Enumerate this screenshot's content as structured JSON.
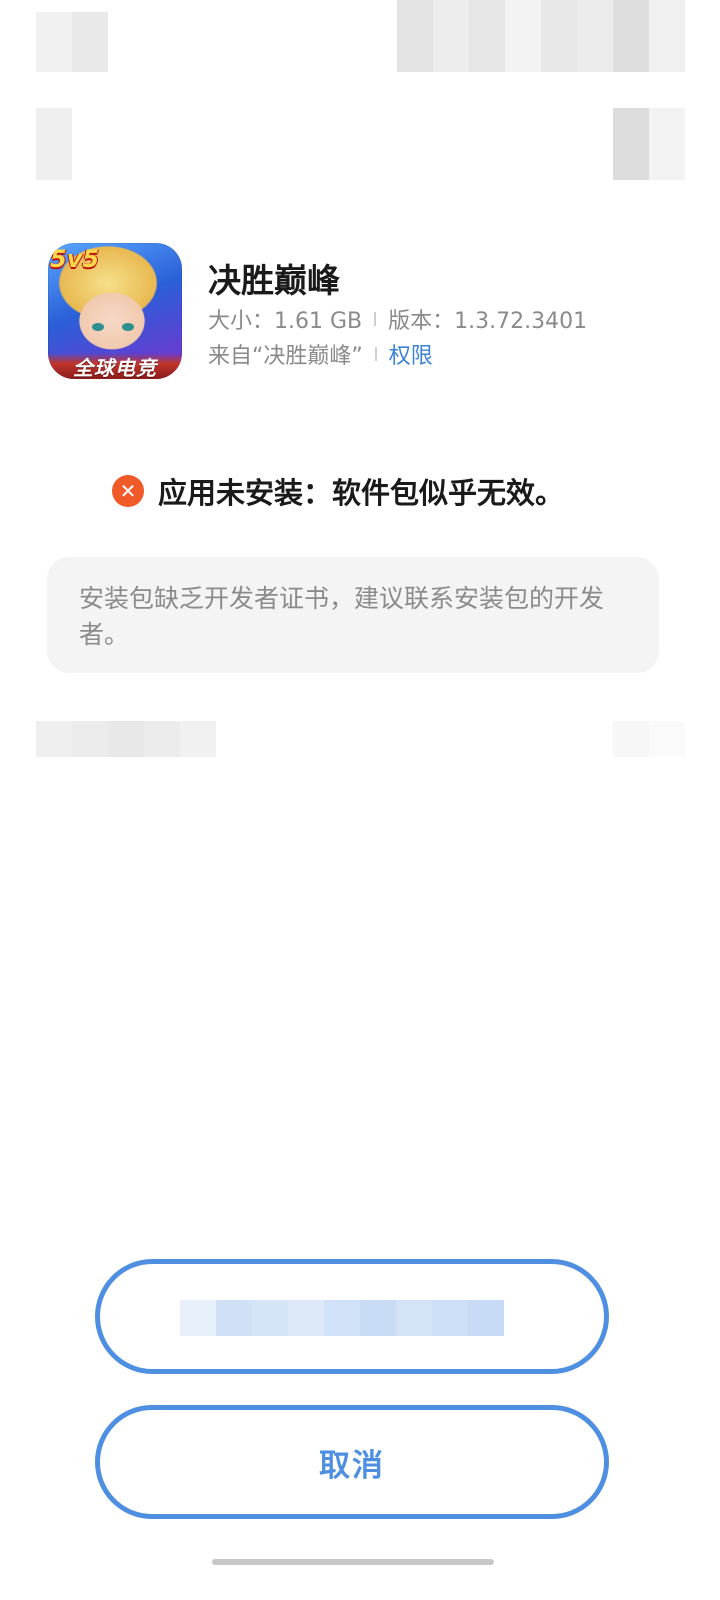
{
  "app": {
    "name": "决胜巅峰",
    "size_label": "大小：1.61 GB",
    "version_label": "版本：1.3.72.3401",
    "source_label": "来自“决胜巅峰”",
    "permissions_link": "权限",
    "icon": {
      "badge_text": "5v5",
      "banner_text": "全球电竞"
    }
  },
  "status": {
    "icon": "close-circle-icon",
    "message": "应用未安装：软件包似乎无效。",
    "color": "#f05a28"
  },
  "details": {
    "text": "安装包缺乏开发者证书，建议联系安装包的开发者。"
  },
  "actions": {
    "primary_label": "",
    "cancel_label": "取消"
  },
  "colors": {
    "accent": "#4f8fe2",
    "link": "#3c83d6",
    "error": "#f05a28"
  }
}
